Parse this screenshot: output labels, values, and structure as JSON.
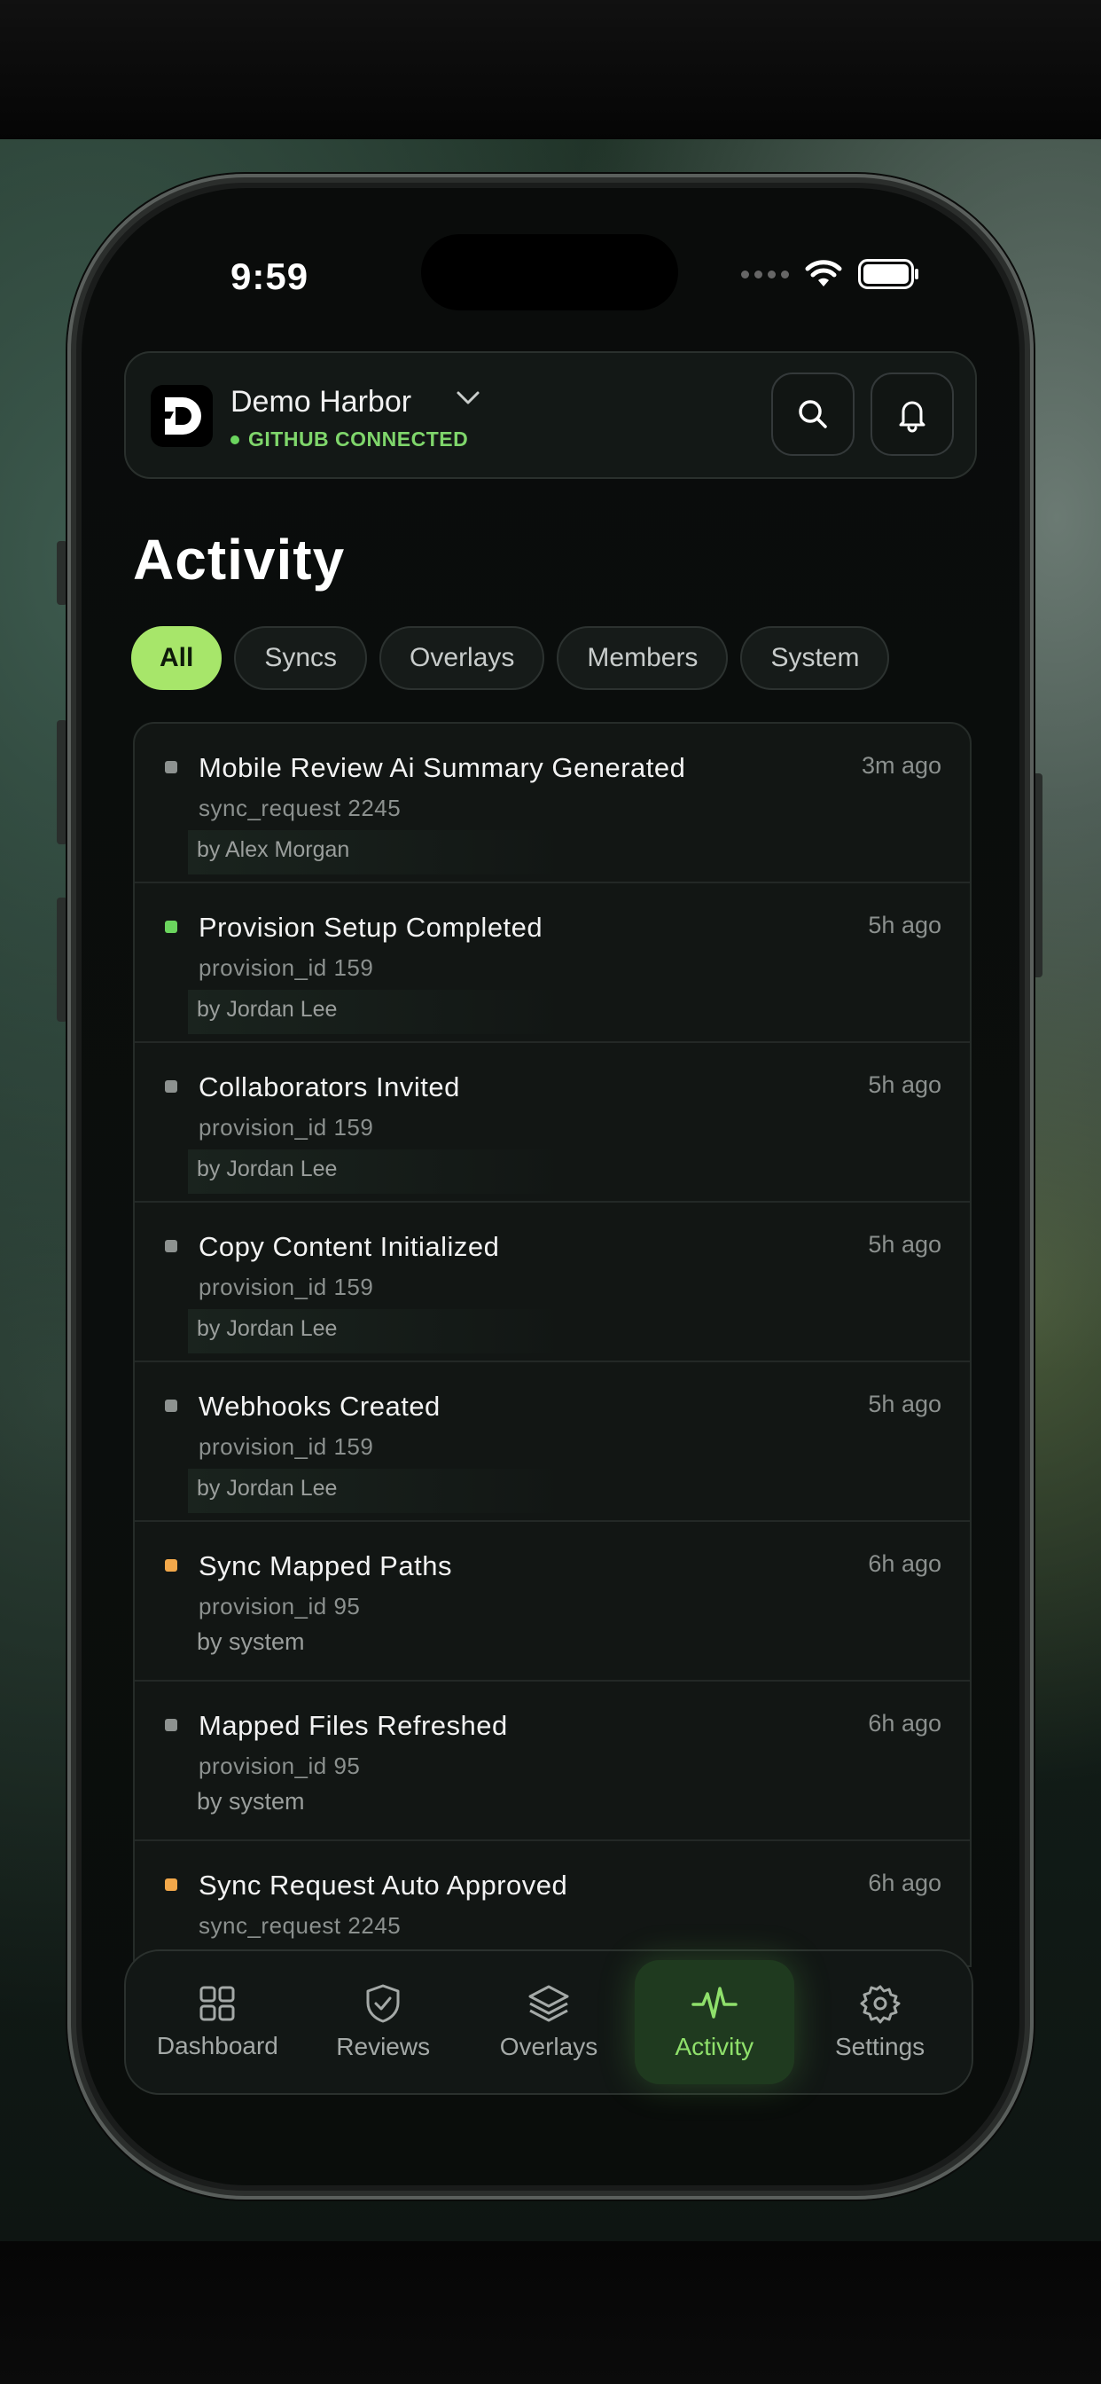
{
  "status_bar": {
    "time": "9:59"
  },
  "header": {
    "org_name": "Demo Harbor",
    "connection_status": "GITHUB CONNECTED",
    "icons": [
      "logo-icon",
      "chevron-down-icon",
      "search-icon",
      "bell-icon"
    ]
  },
  "page": {
    "title": "Activity"
  },
  "filters": [
    {
      "label": "All",
      "active": true
    },
    {
      "label": "Syncs",
      "active": false
    },
    {
      "label": "Overlays",
      "active": false
    },
    {
      "label": "Members",
      "active": false
    },
    {
      "label": "System",
      "active": false
    }
  ],
  "activity": [
    {
      "title": "Mobile Review Ai Summary Generated",
      "subtitle": "sync_request 2245",
      "by": "by Alex Morgan",
      "time": "3m ago",
      "status": "gray"
    },
    {
      "title": "Provision Setup Completed",
      "subtitle": "provision_id 159",
      "by": "by Jordan Lee",
      "time": "5h ago",
      "status": "green"
    },
    {
      "title": "Collaborators Invited",
      "subtitle": "provision_id 159",
      "by": "by Jordan Lee",
      "time": "5h ago",
      "status": "gray"
    },
    {
      "title": "Copy Content Initialized",
      "subtitle": "provision_id 159",
      "by": "by Jordan Lee",
      "time": "5h ago",
      "status": "gray"
    },
    {
      "title": "Webhooks Created",
      "subtitle": "provision_id 159",
      "by": "by Jordan Lee",
      "time": "5h ago",
      "status": "gray"
    },
    {
      "title": "Sync Mapped Paths",
      "subtitle": "provision_id 95",
      "by": "by system",
      "time": "6h ago",
      "status": "orange"
    },
    {
      "title": "Mapped Files Refreshed",
      "subtitle": "provision_id 95",
      "by": "by system",
      "time": "6h ago",
      "status": "gray"
    },
    {
      "title": "Sync Request Auto Approved",
      "subtitle": "sync_request 2245",
      "by": "",
      "time": "6h ago",
      "status": "orange"
    }
  ],
  "tabbar": [
    {
      "label": "Dashboard",
      "icon": "dashboard-icon",
      "active": false
    },
    {
      "label": "Reviews",
      "icon": "shield-check-icon",
      "active": false
    },
    {
      "label": "Overlays",
      "icon": "layers-icon",
      "active": false
    },
    {
      "label": "Activity",
      "icon": "activity-icon",
      "active": true
    },
    {
      "label": "Settings",
      "icon": "gear-icon",
      "active": false
    }
  ],
  "colors": {
    "accent": "#a7e66a",
    "connected": "#7fd66b",
    "status_gray": "#8d9290",
    "status_green": "#6bd55e",
    "status_orange": "#f2a84a"
  }
}
